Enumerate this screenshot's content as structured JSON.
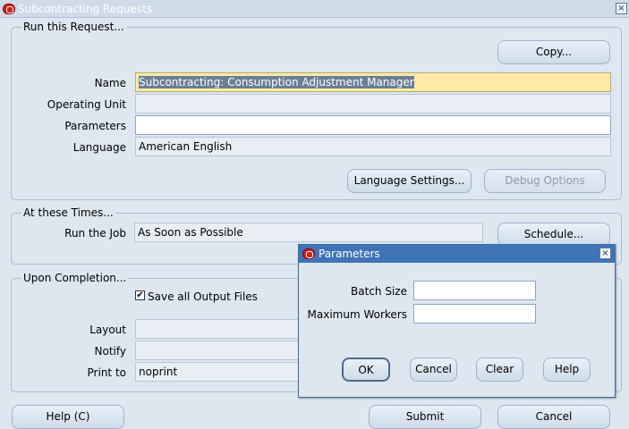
{
  "window": {
    "title": "Subcontracting Requests",
    "close": "×"
  },
  "run_request": {
    "group_label": "Run this Request...",
    "copy_button": "Copy...",
    "name_label": "Name",
    "name_value": "Subcontracting: Consumption Adjustment Manager",
    "operating_unit_label": "Operating Unit",
    "operating_unit_value": "",
    "parameters_label": "Parameters",
    "parameters_value": "",
    "language_label": "Language",
    "language_value": "American English",
    "language_settings_button": "Language Settings...",
    "debug_options_button": "Debug Options"
  },
  "times": {
    "group_label": "At these Times...",
    "run_job_label": "Run the Job",
    "run_job_value": "As Soon as Possible",
    "schedule_button": "Schedule..."
  },
  "completion": {
    "group_label": "Upon Completion...",
    "save_output_label": "Save all Output Files",
    "save_output_checked": true,
    "check_mark": "✔",
    "layout_label": "Layout",
    "layout_value": "",
    "notify_label": "Notify",
    "notify_value": "",
    "print_to_label": "Print to",
    "print_to_value": "noprint"
  },
  "footer": {
    "help_button": "Help (C)",
    "submit_button": "Submit",
    "cancel_button": "Cancel"
  },
  "dialog": {
    "title": "Parameters",
    "close": "×",
    "batch_size_label": "Batch Size",
    "batch_size_value": "",
    "max_workers_label": "Maximum Workers",
    "max_workers_value": "",
    "ok_button": "OK",
    "cancel_button": "Cancel",
    "clear_button": "Clear",
    "help_button": "Help"
  },
  "colors": {
    "background": "#dee6ef",
    "dialog_title": "#3f74b7",
    "required_field": "#ffe9a6",
    "oracle_red": "#d21f1f"
  }
}
